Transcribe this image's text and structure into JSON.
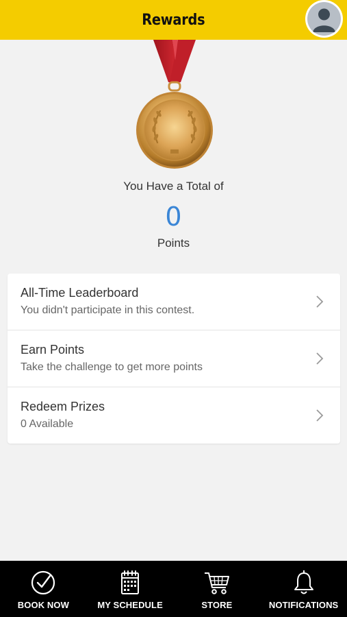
{
  "header": {
    "title": "Rewards",
    "avatar_icon": "user-avatar-icon"
  },
  "medal": {
    "icon": "gold-medal-icon"
  },
  "points": {
    "total_label": "You Have a Total of",
    "value": "0",
    "unit_label": "Points"
  },
  "menu": {
    "items": [
      {
        "title": "All-Time Leaderboard",
        "subtitle": "You didn't participate in this contest."
      },
      {
        "title": "Earn Points",
        "subtitle": "Take the challenge to get more points"
      },
      {
        "title": "Redeem Prizes",
        "subtitle": "0 Available"
      }
    ]
  },
  "bottom_nav": {
    "items": [
      {
        "label": "BOOK NOW",
        "icon": "check-circle-icon"
      },
      {
        "label": "MY SCHEDULE",
        "icon": "calendar-icon"
      },
      {
        "label": "STORE",
        "icon": "cart-icon"
      },
      {
        "label": "NOTIFICATIONS",
        "icon": "bell-icon"
      }
    ]
  },
  "colors": {
    "header_bg": "#f4cc00",
    "accent_blue": "#3b86d6",
    "nav_bg": "#000000",
    "ribbon_red": "#c8202b",
    "medal_gold": "#d4a04a"
  }
}
